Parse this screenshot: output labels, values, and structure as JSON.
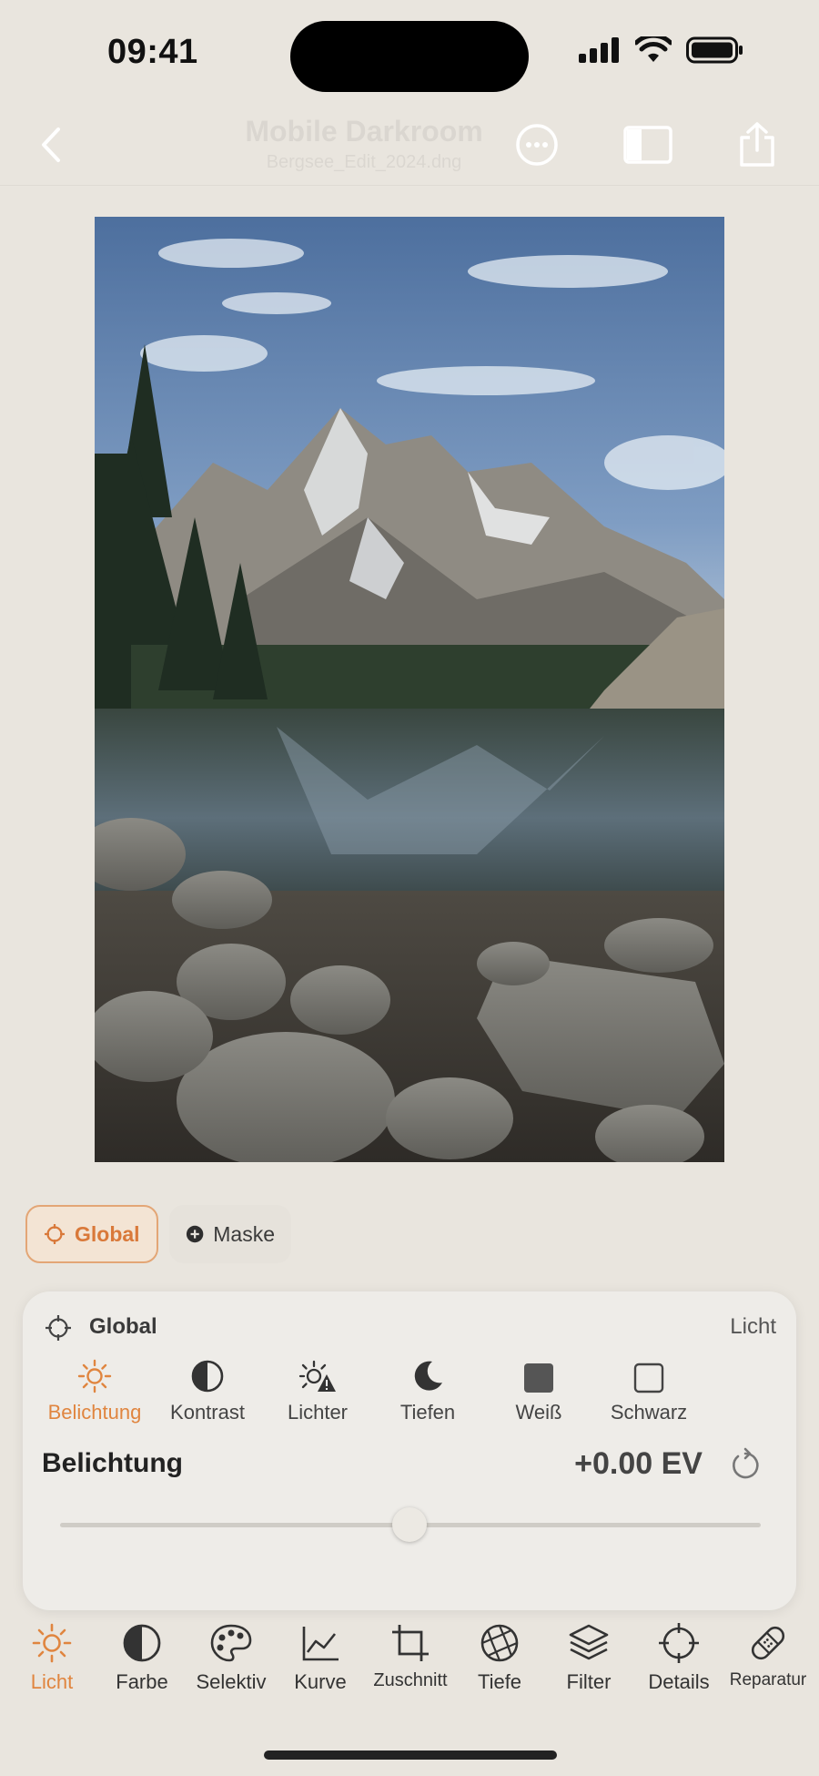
{
  "status_bar": {
    "time": "09:41"
  },
  "nav": {
    "title": "Mobile Darkroom",
    "subtitle": "Bergsee_Edit_2024.dng",
    "back_icon": "chevron-left-icon",
    "more_icon": "ellipsis-circle-icon",
    "compare_icon": "split-compare-icon",
    "share_icon": "share-icon"
  },
  "photo": {
    "description_icon": "mountain-lake-photo"
  },
  "chips": {
    "global": "Global",
    "mask": "Maske"
  },
  "panel": {
    "title": "Global",
    "category": "Licht",
    "tools": [
      {
        "label": "Belichtung",
        "icon": "sun-icon",
        "active": true
      },
      {
        "label": "Kontrast",
        "icon": "contrast-icon",
        "active": false
      },
      {
        "label": "Lichter",
        "icon": "highlights-warning-icon",
        "active": false
      },
      {
        "label": "Tiefen",
        "icon": "moon-icon",
        "active": false
      },
      {
        "label": "Weiß",
        "icon": "filled-square-icon",
        "active": false
      },
      {
        "label": "Schwarz",
        "icon": "outline-square-icon",
        "active": false
      }
    ],
    "param_name": "Belichtung",
    "param_value": "+0.00 EV",
    "slider_level": 0.5
  },
  "tabs": [
    {
      "label": "Licht",
      "icon": "sun-icon",
      "active": true
    },
    {
      "label": "Farbe",
      "icon": "contrast-icon",
      "active": false
    },
    {
      "label": "Selektiv",
      "icon": "palette-icon",
      "active": false
    },
    {
      "label": "Kurve",
      "icon": "curve-chart-icon",
      "active": false
    },
    {
      "label": "Zuschnitt",
      "icon": "crop-icon",
      "active": false
    },
    {
      "label": "Tiefe",
      "icon": "aperture-icon",
      "active": false
    },
    {
      "label": "Filter",
      "icon": "layers-icon",
      "active": false
    },
    {
      "label": "Details",
      "icon": "crosshair-icon",
      "active": false
    },
    {
      "label": "Reparatur",
      "icon": "bandage-icon",
      "active": false
    }
  ],
  "colors": {
    "accent": "#e0853f",
    "background": "#e9e5de",
    "panel": "#eeece8"
  }
}
